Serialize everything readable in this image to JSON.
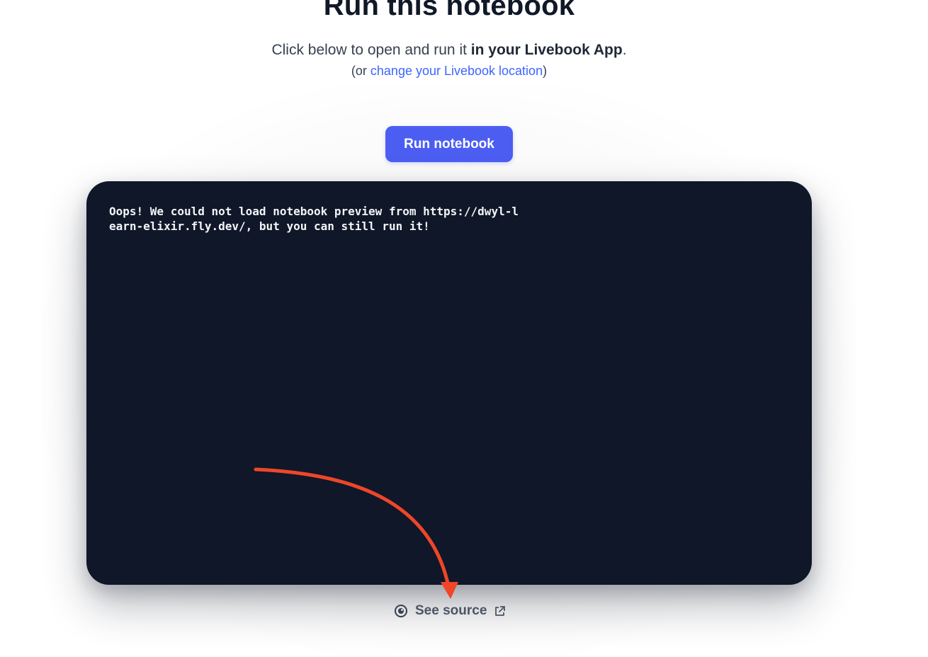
{
  "header": {
    "title": "Run this notebook",
    "subtitle_prefix": "Click below to open and run it ",
    "subtitle_bold": "in your Livebook App",
    "subtitle_suffix": ".",
    "location_prefix": "(or ",
    "location_link": "change your Livebook location",
    "location_suffix": ")"
  },
  "actions": {
    "run_label": "Run notebook"
  },
  "preview": {
    "message": "Oops! We could not load notebook preview from https://dwyl-learn-elixir.fly.dev/, but you can still run it!"
  },
  "footer": {
    "see_source_label": "See source",
    "see_source_icon": "eye-icon",
    "external_icon": "external-link-icon"
  },
  "colors": {
    "accent": "#4c5ef2",
    "link": "#3e64ff",
    "preview_bg": "#0f1729",
    "annotation_arrow": "#ef4628"
  }
}
